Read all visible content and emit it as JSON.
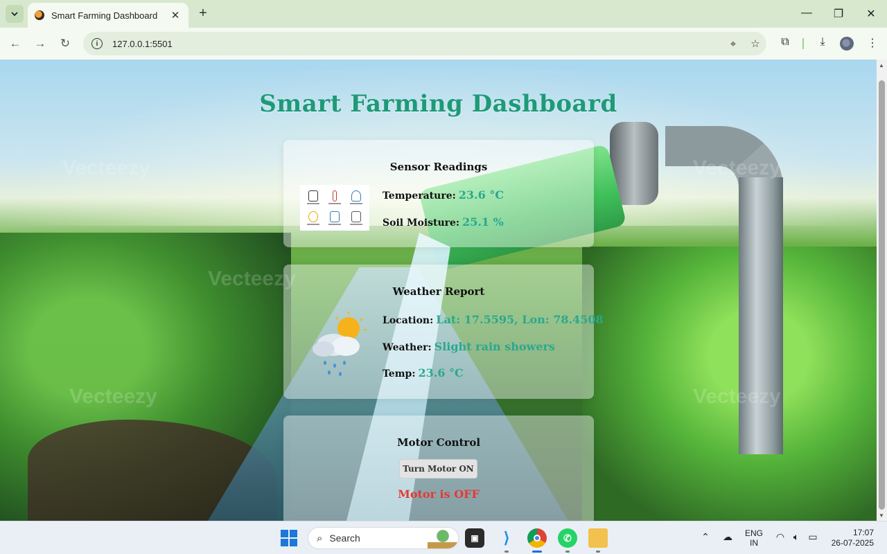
{
  "browser": {
    "tab_title": "Smart Farming Dashboard",
    "url": "127.0.0.1:5501"
  },
  "page": {
    "title": "Smart Farming Dashboard",
    "watermark": "Vecteezy"
  },
  "sensor": {
    "heading": "Sensor Readings",
    "temperature_label": "Temperature:",
    "temperature_value": "23.6 °C",
    "soil_label": "Soil Moisture:",
    "soil_value": "25.1 %"
  },
  "weather": {
    "heading": "Weather Report",
    "location_label": "Location:",
    "location_value": "Lat: 17.5595, Lon: 78.4508",
    "weather_label": "Weather:",
    "weather_value": "Slight rain showers",
    "temp_label": "Temp:",
    "temp_value": "23.6 °C"
  },
  "motor": {
    "heading": "Motor Control",
    "button_label": "Turn Motor ON",
    "status": "Motor is OFF"
  },
  "taskbar": {
    "search_label": "Search",
    "lang_line1": "ENG",
    "lang_line2": "IN",
    "time": "17:07",
    "date": "26-07-2025"
  },
  "colors": {
    "title": "#1e9a78",
    "value": "#2aa88e",
    "status_off": "#e53935"
  }
}
